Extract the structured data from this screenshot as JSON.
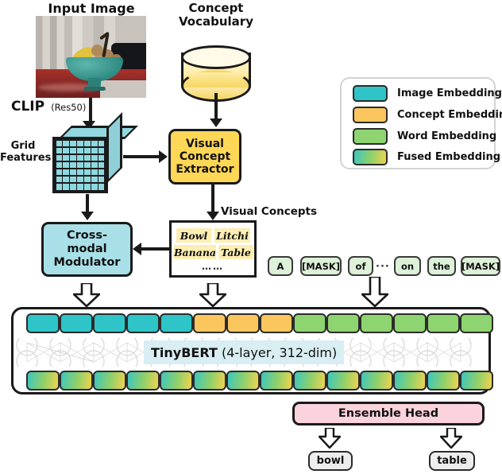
{
  "figure": {
    "title_input_image": "Input Image",
    "title_concept_vocab_line1": "Concept",
    "title_concept_vocab_line2": "Vocabulary"
  },
  "labels": {
    "clip": "CLIP",
    "clip_variant": "(Res50)",
    "grid_features_line1": "Grid",
    "grid_features_line2": "Features",
    "visual_concepts": "Visual Concepts"
  },
  "blocks": {
    "visual_concept_extractor": [
      "Visual",
      "Concept",
      "Extractor"
    ],
    "cross_modal_modulator": [
      "Cross-",
      "modal",
      "Modulator"
    ],
    "ensemble_head": "Ensemble Head",
    "tinybert_name": "TinyBERT",
    "tinybert_spec": "(4-layer, 312-dim)"
  },
  "visual_concepts_box": {
    "concepts": [
      "Bowl",
      "Litchi",
      "Banana",
      "Table"
    ],
    "ellipsis": "……"
  },
  "text_tokens": [
    {
      "text": "A",
      "type": "word"
    },
    {
      "text": "[MASK]",
      "type": "mask"
    },
    {
      "text": "of",
      "type": "word"
    },
    {
      "text": "···",
      "type": "ellipsis"
    },
    {
      "text": "on",
      "type": "word"
    },
    {
      "text": "the",
      "type": "word"
    },
    {
      "text": "[MASK]",
      "type": "mask"
    }
  ],
  "embeddings": {
    "image_count": 5,
    "concept_count": 3,
    "word_count": 6,
    "total": 14,
    "fused_count": 14
  },
  "outputs": [
    "bowl",
    "table"
  ],
  "legend": {
    "items": [
      {
        "label": "Image Embedding",
        "color": "#2fc4c8"
      },
      {
        "label": "Concept Embedding",
        "color": "#fcc65f"
      },
      {
        "label": "Word Embedding",
        "color": "#8ed470"
      },
      {
        "label": "Fused Embedding",
        "color": "gradient"
      }
    ]
  },
  "colors": {
    "image_embedding": "#2fc4c8",
    "concept_embedding": "#fcc65f",
    "word_embedding": "#8ed470",
    "fused_start": "#3cc6c0",
    "fused_mid": "#8ed06a",
    "fused_end": "#f2d24f",
    "vce_fill": "#ffd756",
    "cmm_fill": "#a9e0e8",
    "ensemble_fill": "#fbd3dc",
    "tinybert_label_bg": "#d9eef2",
    "concept_chip": "#fdeeb3",
    "token_fill": "#ddf0d8",
    "outline": "#1a1a1a"
  }
}
